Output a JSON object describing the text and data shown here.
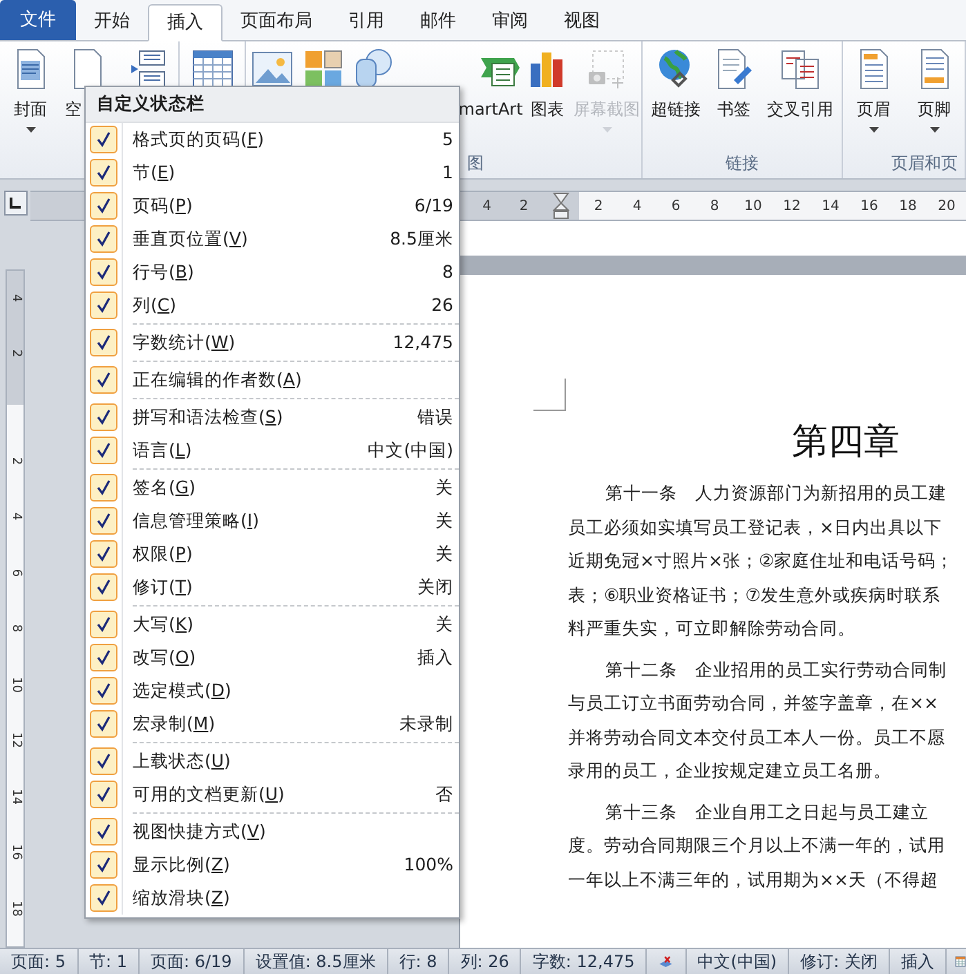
{
  "tabs": [
    {
      "label": "文件",
      "kind": "file",
      "selected": false
    },
    {
      "label": "开始",
      "kind": "tab",
      "selected": false
    },
    {
      "label": "插入",
      "kind": "tab",
      "selected": true
    },
    {
      "label": "页面布局",
      "kind": "tab",
      "selected": false
    },
    {
      "label": "引用",
      "kind": "tab",
      "selected": false
    },
    {
      "label": "邮件",
      "kind": "tab",
      "selected": false
    },
    {
      "label": "审阅",
      "kind": "tab",
      "selected": false
    },
    {
      "label": "视图",
      "kind": "tab",
      "selected": false
    }
  ],
  "ribbon": {
    "groups": [
      {
        "items": [
          {
            "kind": "cover",
            "label": "封面",
            "dropdown": true,
            "disabled": false
          },
          {
            "kind": "blank",
            "label": "空",
            "disabled": false
          },
          {
            "kind": "pagebreak",
            "disabled": false
          }
        ]
      },
      {
        "items": [
          {
            "kind": "table",
            "disabled": false
          }
        ]
      },
      {
        "label": "图",
        "items": [
          {
            "kind": "picture",
            "disabled": false
          },
          {
            "kind": "clipart",
            "disabled": false
          },
          {
            "kind": "shapes",
            "disabled": false
          },
          {
            "kind": "smartart",
            "label": "martArt",
            "dropdown": false,
            "disabled": false
          },
          {
            "kind": "chart",
            "label": "图表",
            "dropdown": false,
            "disabled": false
          },
          {
            "kind": "screenshot",
            "label": "屏幕截图",
            "dropdown": true,
            "disabled": true
          }
        ]
      },
      {
        "label": "链接",
        "items": [
          {
            "kind": "hyperlink",
            "label": "超链接",
            "dropdown": false,
            "disabled": false
          },
          {
            "kind": "bookmark",
            "label": "书签",
            "dropdown": false,
            "disabled": false
          },
          {
            "kind": "crossref",
            "label": "交叉引用",
            "dropdown": false,
            "disabled": false
          }
        ]
      },
      {
        "label": "页眉和页",
        "items": [
          {
            "kind": "header",
            "label": "页眉",
            "dropdown": true,
            "disabled": false
          },
          {
            "kind": "footer",
            "label": "页脚",
            "dropdown": true,
            "disabled": false
          }
        ]
      }
    ]
  },
  "ruler": {
    "left_labels": [
      "4",
      "2"
    ],
    "labels": [
      "2",
      "4",
      "6",
      "8",
      "10",
      "12",
      "14",
      "16",
      "18",
      "20"
    ]
  },
  "vertical_ruler": {
    "top_labels": [
      "4",
      "2"
    ],
    "labels": [
      "2",
      "4",
      "6",
      "8",
      "10",
      "12",
      "14",
      "16",
      "18"
    ]
  },
  "document": {
    "title": "第四章",
    "paragraphs": [
      [
        "第十一条　人力资源部门为新招用的员工建",
        "员工必须如实填写员工登记表，×日内出具以下",
        "近期免冠×寸照片×张；②家庭住址和电话号码；",
        "表；⑥职业资格证书；⑦发生意外或疾病时联系",
        "料严重失实，可立即解除劳动合同。"
      ],
      [
        "第十二条　企业招用的员工实行劳动合同制",
        "与员工订立书面劳动合同，并签字盖章，在××",
        "并将劳动合同文本交付员工本人一份。员工不愿",
        "录用的员工，企业按规定建立员工名册。"
      ],
      [
        "第十三条　企业自用工之日起与员工建立",
        "度。劳动合同期限三个月以上不满一年的，试用",
        "一年以上不满三年的，试用期为××天（不得超"
      ]
    ]
  },
  "context_menu": {
    "title": "自定义状态栏",
    "groups": [
      [
        {
          "label": "格式页的页码(F)",
          "value": "5",
          "checked": true
        },
        {
          "label": "节(E)",
          "value": "1",
          "checked": true
        },
        {
          "label": "页码(P)",
          "value": "6/19",
          "checked": true
        },
        {
          "label": "垂直页位置(V)",
          "value": "8.5厘米",
          "checked": true
        },
        {
          "label": "行号(B)",
          "value": "8",
          "checked": true
        },
        {
          "label": "列(C)",
          "value": "26",
          "checked": true
        }
      ],
      [
        {
          "label": "字数统计(W)",
          "value": "12,475",
          "checked": true
        }
      ],
      [
        {
          "label": "正在编辑的作者数(A)",
          "checked": true
        }
      ],
      [
        {
          "label": "拼写和语法检查(S)",
          "value": "错误",
          "checked": true
        },
        {
          "label": "语言(L)",
          "value": "中文(中国)",
          "checked": true
        }
      ],
      [
        {
          "label": "签名(G)",
          "value": "关",
          "checked": true
        },
        {
          "label": "信息管理策略(I)",
          "value": "关",
          "checked": true
        },
        {
          "label": "权限(P)",
          "value": "关",
          "checked": true
        },
        {
          "label": "修订(T)",
          "value": "关闭",
          "checked": true
        }
      ],
      [
        {
          "label": "大写(K)",
          "value": "关",
          "checked": true
        },
        {
          "label": "改写(O)",
          "value": "插入",
          "checked": true
        },
        {
          "label": "选定模式(D)",
          "checked": true
        },
        {
          "label": "宏录制(M)",
          "value": "未录制",
          "checked": true
        }
      ],
      [
        {
          "label": "上载状态(U)",
          "checked": true
        },
        {
          "label": "可用的文档更新(U)",
          "value": "否",
          "checked": true
        }
      ],
      [
        {
          "label": "视图快捷方式(V)",
          "checked": true
        },
        {
          "label": "显示比例(Z)",
          "value": "100%",
          "checked": true
        },
        {
          "label": "缩放滑块(Z)",
          "checked": true
        }
      ]
    ]
  },
  "status_bar": {
    "left": [
      "页面: 5",
      "节: 1",
      "页面: 6/19",
      "设置值: 8.5厘米",
      "行: 8",
      "列: 26",
      "字数: 12,475"
    ],
    "language": "中文(中国)",
    "right": [
      "修订: 关闭",
      "插入"
    ]
  }
}
